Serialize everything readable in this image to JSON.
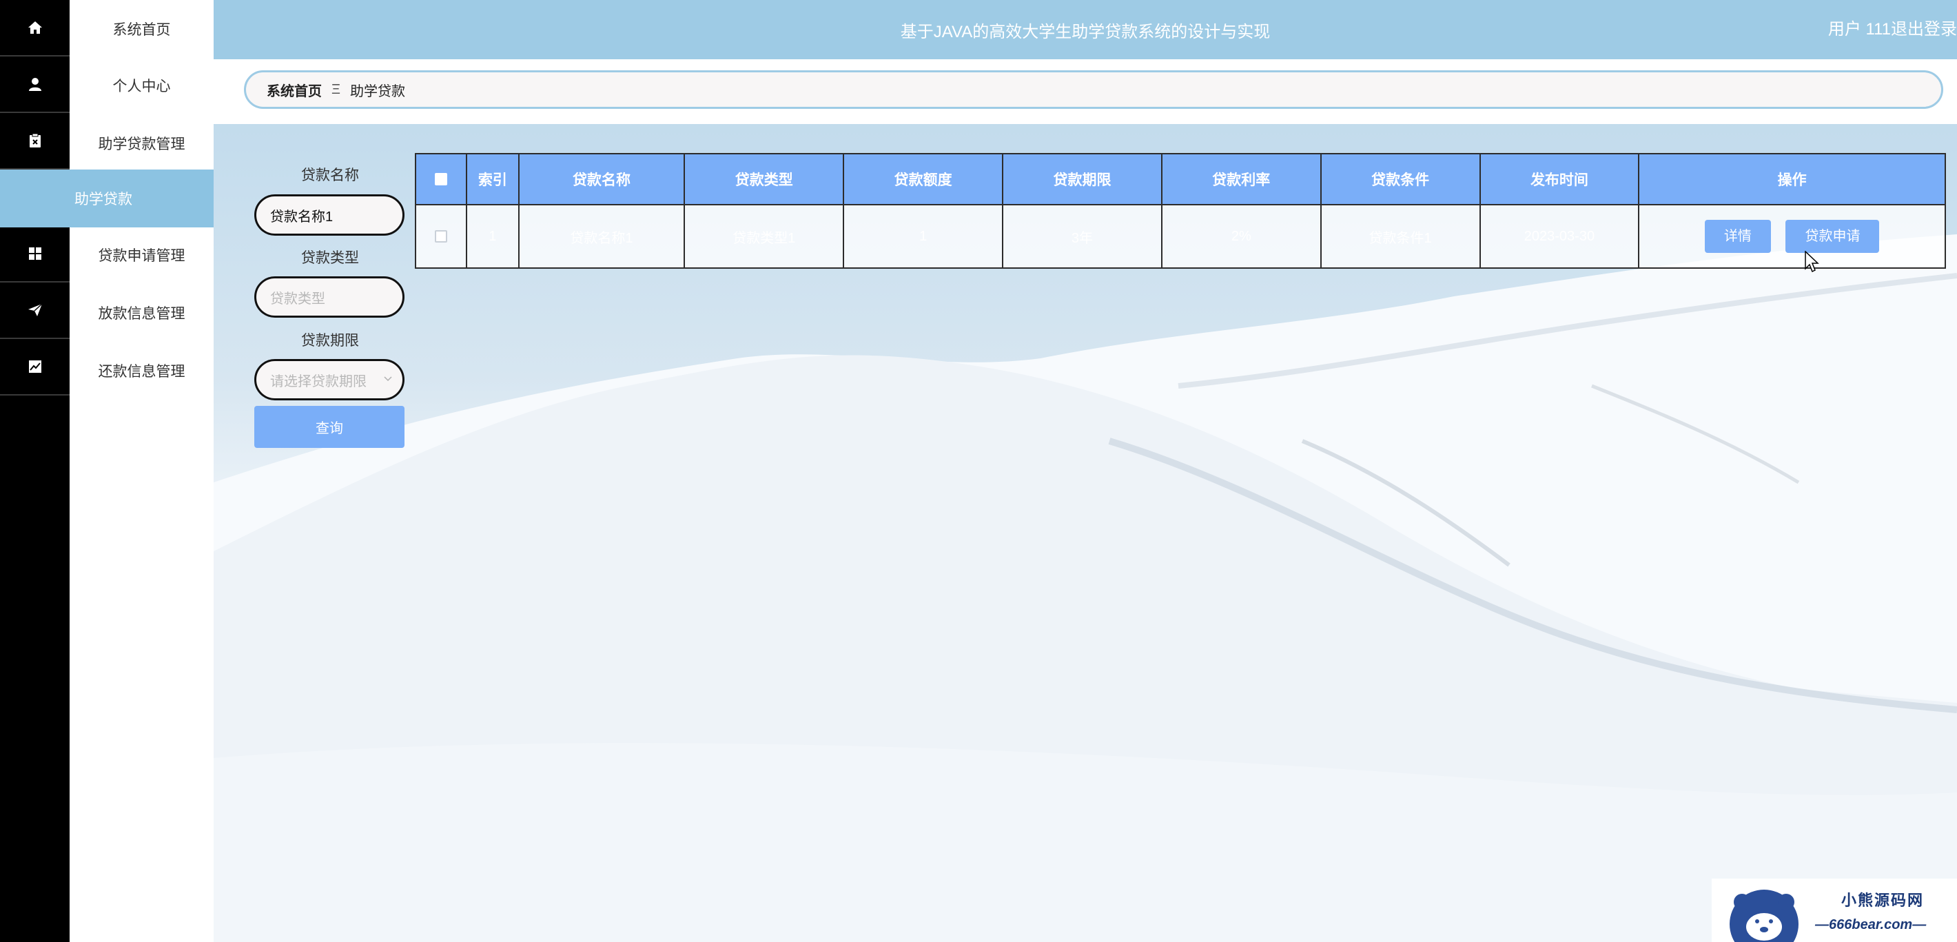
{
  "app": {
    "title": "基于JAVA的高效大学生助学贷款系统的设计与实现",
    "user": "用户 111",
    "logout": "退出登录"
  },
  "sidebar": {
    "items": [
      {
        "label": "系统首页",
        "icon": "home-icon"
      },
      {
        "label": "个人中心",
        "icon": "user-icon"
      },
      {
        "label": "助学贷款管理",
        "icon": "clipboard-icon"
      },
      {
        "label": "贷款申请管理",
        "icon": "grid-icon"
      },
      {
        "label": "放款信息管理",
        "icon": "send-icon"
      },
      {
        "label": "还款信息管理",
        "icon": "chart-icon"
      }
    ],
    "active_sub": "助学贷款"
  },
  "breadcrumb": {
    "home": "系统首页",
    "separator": "Ξ",
    "current": "助学贷款"
  },
  "search": {
    "name_label": "贷款名称",
    "name_value": "贷款名称1",
    "type_label": "贷款类型",
    "type_placeholder": "贷款类型",
    "term_label": "贷款期限",
    "term_placeholder": "请选择贷款期限",
    "query_button": "查询"
  },
  "table": {
    "headers": [
      "索引",
      "贷款名称",
      "贷款类型",
      "贷款额度",
      "贷款期限",
      "贷款利率",
      "贷款条件",
      "发布时间",
      "操作"
    ],
    "rows": [
      {
        "index": "1",
        "name": "贷款名称1",
        "type": "贷款类型1",
        "amount": "1",
        "term": "3年",
        "rate": "2%",
        "condition": "贷款条件1",
        "published": "2023-03-30"
      }
    ],
    "actions": {
      "detail": "详情",
      "apply": "贷款申请"
    }
  },
  "watermark": {
    "title": "小熊源码网",
    "subtitle": "—666bear.com—"
  },
  "colors": {
    "rail": "#000000",
    "topbar": "#9ecbe5",
    "active_sidebar": "#8cc3e2",
    "accent_button": "#7aaef8"
  }
}
